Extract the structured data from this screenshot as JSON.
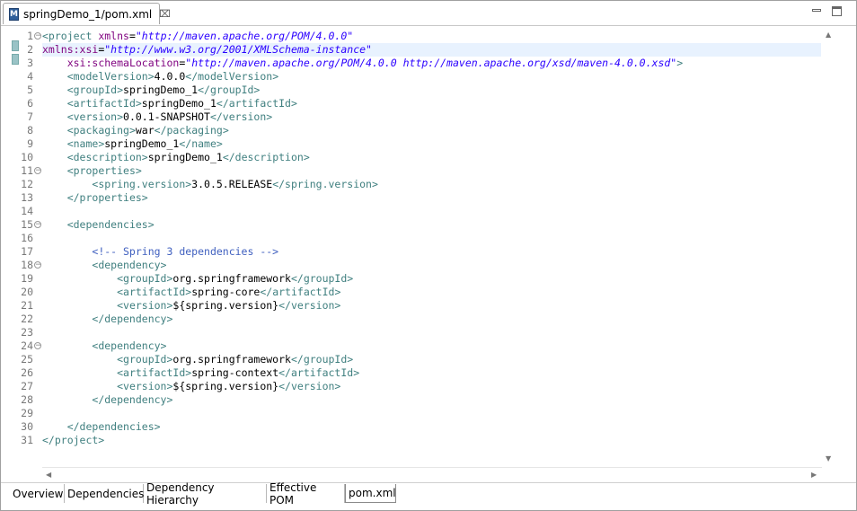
{
  "editor": {
    "tab_title": "springDemo_1/pom.xml",
    "tab_icon_letter": "M",
    "close_glyph": "⌧"
  },
  "lines": [
    {
      "n": "1",
      "fold": true,
      "tokens": [
        [
          "tag",
          "<project "
        ],
        [
          "attr",
          "xmlns"
        ],
        [
          "txt",
          "="
        ],
        [
          "str",
          "\"http://maven.apache.org/POM/4.0.0\""
        ]
      ]
    },
    {
      "n": "2",
      "hl": true,
      "tokens": [
        [
          "attr",
          "xmlns:xsi"
        ],
        [
          "txt",
          "="
        ],
        [
          "str",
          "\"http://www.w3.org/2001/XMLSchema-instance\""
        ]
      ]
    },
    {
      "n": "3",
      "tokens": [
        [
          "txt",
          "    "
        ],
        [
          "attr",
          "xsi:schemaLocation"
        ],
        [
          "txt",
          "="
        ],
        [
          "str",
          "\"http://maven.apache.org/POM/4.0.0 http://maven.apache.org/xsd/maven-4.0.0.xsd\""
        ],
        [
          "tag",
          ">"
        ]
      ]
    },
    {
      "n": "4",
      "tokens": [
        [
          "txt",
          "    "
        ],
        [
          "tag",
          "<modelVersion>"
        ],
        [
          "txt",
          "4.0.0"
        ],
        [
          "tag",
          "</modelVersion>"
        ]
      ]
    },
    {
      "n": "5",
      "tokens": [
        [
          "txt",
          "    "
        ],
        [
          "tag",
          "<groupId>"
        ],
        [
          "txt",
          "springDemo_1"
        ],
        [
          "tag",
          "</groupId>"
        ]
      ]
    },
    {
      "n": "6",
      "tokens": [
        [
          "txt",
          "    "
        ],
        [
          "tag",
          "<artifactId>"
        ],
        [
          "txt",
          "springDemo_1"
        ],
        [
          "tag",
          "</artifactId>"
        ]
      ]
    },
    {
      "n": "7",
      "tokens": [
        [
          "txt",
          "    "
        ],
        [
          "tag",
          "<version>"
        ],
        [
          "txt",
          "0.0.1-SNAPSHOT"
        ],
        [
          "tag",
          "</version>"
        ]
      ]
    },
    {
      "n": "8",
      "tokens": [
        [
          "txt",
          "    "
        ],
        [
          "tag",
          "<packaging>"
        ],
        [
          "txt",
          "war"
        ],
        [
          "tag",
          "</packaging>"
        ]
      ]
    },
    {
      "n": "9",
      "tokens": [
        [
          "txt",
          "    "
        ],
        [
          "tag",
          "<name>"
        ],
        [
          "txt",
          "springDemo_1"
        ],
        [
          "tag",
          "</name>"
        ]
      ]
    },
    {
      "n": "10",
      "tokens": [
        [
          "txt",
          "    "
        ],
        [
          "tag",
          "<description>"
        ],
        [
          "txt",
          "springDemo_1"
        ],
        [
          "tag",
          "</description>"
        ]
      ]
    },
    {
      "n": "11",
      "fold": true,
      "tokens": [
        [
          "txt",
          "    "
        ],
        [
          "tag",
          "<properties>"
        ]
      ]
    },
    {
      "n": "12",
      "tokens": [
        [
          "txt",
          "        "
        ],
        [
          "tag",
          "<spring.version>"
        ],
        [
          "txt",
          "3.0.5.RELEASE"
        ],
        [
          "tag",
          "</spring.version>"
        ]
      ]
    },
    {
      "n": "13",
      "tokens": [
        [
          "txt",
          "    "
        ],
        [
          "tag",
          "</properties>"
        ]
      ]
    },
    {
      "n": "14",
      "tokens": []
    },
    {
      "n": "15",
      "fold": true,
      "tokens": [
        [
          "txt",
          "    "
        ],
        [
          "tag",
          "<dependencies>"
        ]
      ]
    },
    {
      "n": "16",
      "tokens": []
    },
    {
      "n": "17",
      "tokens": [
        [
          "txt",
          "        "
        ],
        [
          "cmt",
          "<!-- Spring 3 dependencies -->"
        ]
      ]
    },
    {
      "n": "18",
      "fold": true,
      "tokens": [
        [
          "txt",
          "        "
        ],
        [
          "tag",
          "<dependency>"
        ]
      ]
    },
    {
      "n": "19",
      "tokens": [
        [
          "txt",
          "            "
        ],
        [
          "tag",
          "<groupId>"
        ],
        [
          "txt",
          "org.springframework"
        ],
        [
          "tag",
          "</groupId>"
        ]
      ]
    },
    {
      "n": "20",
      "tokens": [
        [
          "txt",
          "            "
        ],
        [
          "tag",
          "<artifactId>"
        ],
        [
          "txt",
          "spring-core"
        ],
        [
          "tag",
          "</artifactId>"
        ]
      ]
    },
    {
      "n": "21",
      "tokens": [
        [
          "txt",
          "            "
        ],
        [
          "tag",
          "<version>"
        ],
        [
          "txt",
          "${spring.version}"
        ],
        [
          "tag",
          "</version>"
        ]
      ]
    },
    {
      "n": "22",
      "tokens": [
        [
          "txt",
          "        "
        ],
        [
          "tag",
          "</dependency>"
        ]
      ]
    },
    {
      "n": "23",
      "tokens": []
    },
    {
      "n": "24",
      "fold": true,
      "tokens": [
        [
          "txt",
          "        "
        ],
        [
          "tag",
          "<dependency>"
        ]
      ]
    },
    {
      "n": "25",
      "tokens": [
        [
          "txt",
          "            "
        ],
        [
          "tag",
          "<groupId>"
        ],
        [
          "txt",
          "org.springframework"
        ],
        [
          "tag",
          "</groupId>"
        ]
      ]
    },
    {
      "n": "26",
      "tokens": [
        [
          "txt",
          "            "
        ],
        [
          "tag",
          "<artifactId>"
        ],
        [
          "txt",
          "spring-context"
        ],
        [
          "tag",
          "</artifactId>"
        ]
      ]
    },
    {
      "n": "27",
      "tokens": [
        [
          "txt",
          "            "
        ],
        [
          "tag",
          "<version>"
        ],
        [
          "txt",
          "${spring.version}"
        ],
        [
          "tag",
          "</version>"
        ]
      ]
    },
    {
      "n": "28",
      "tokens": [
        [
          "txt",
          "        "
        ],
        [
          "tag",
          "</dependency>"
        ]
      ]
    },
    {
      "n": "29",
      "tokens": []
    },
    {
      "n": "30",
      "tokens": [
        [
          "txt",
          "    "
        ],
        [
          "tag",
          "</dependencies>"
        ]
      ]
    },
    {
      "n": "31",
      "tokens": [
        [
          "tag",
          "</project>"
        ]
      ]
    }
  ],
  "bottom_tabs": [
    "Overview",
    "Dependencies",
    "Dependency Hierarchy",
    "Effective POM",
    "pom.xml"
  ],
  "active_bottom_tab": "pom.xml",
  "colors": {
    "tag": "#3f7f7f",
    "attr": "#7f007f",
    "string": "#2a00ff",
    "comment": "#3f5fbf",
    "highlight_line": "#e8f2fe"
  }
}
